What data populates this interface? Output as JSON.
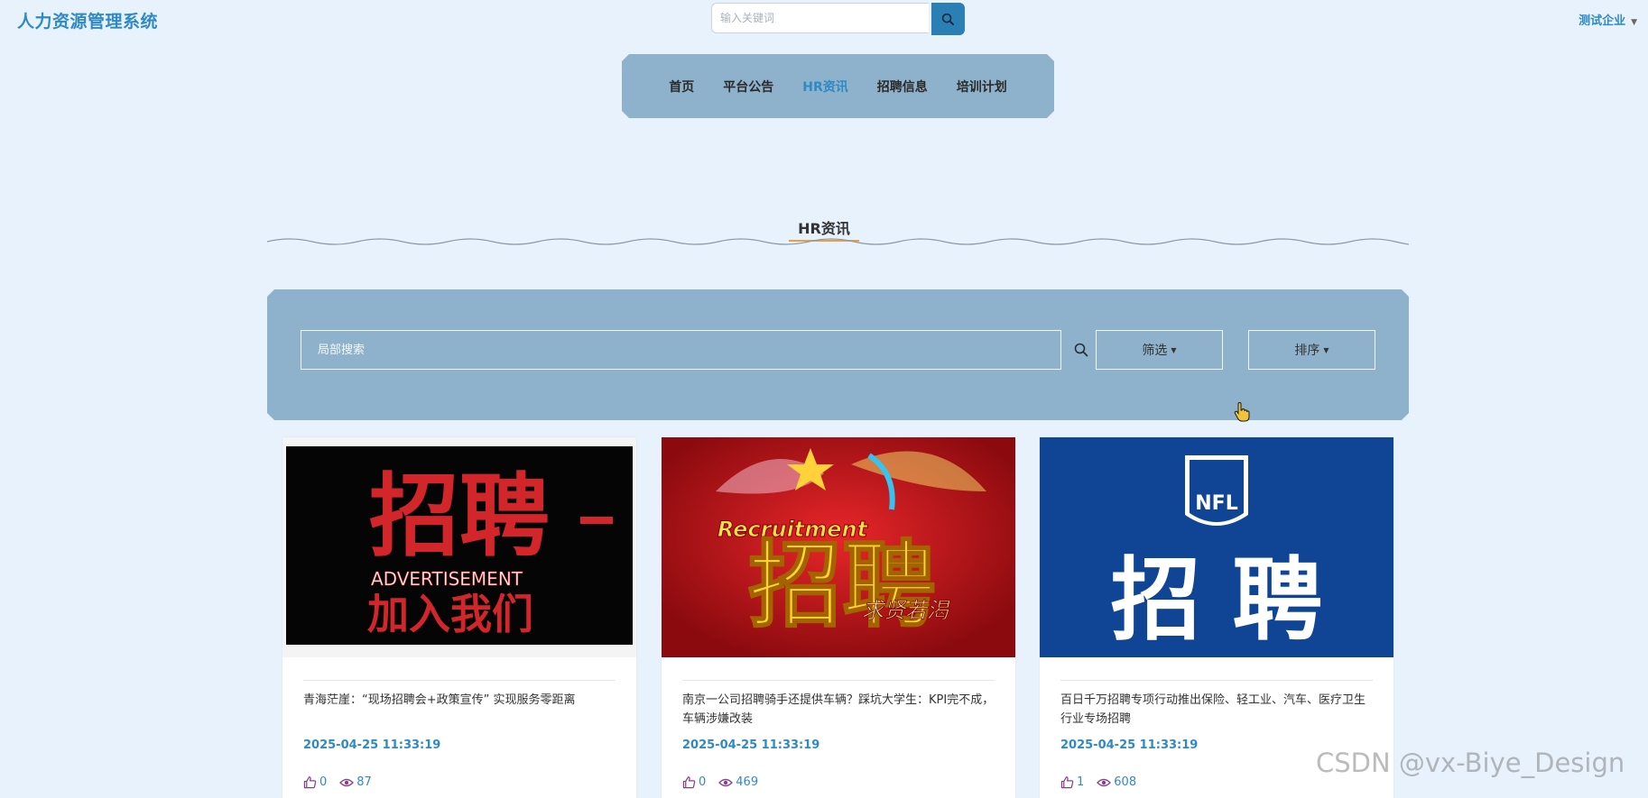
{
  "header": {
    "brand": "人力资源管理系统",
    "search_placeholder": "输入关键词",
    "user_label": "测试企业"
  },
  "nav": {
    "items": [
      {
        "label": "首页"
      },
      {
        "label": "平台公告"
      },
      {
        "label": "HR资讯"
      },
      {
        "label": "招聘信息"
      },
      {
        "label": "培训计划"
      }
    ],
    "active": "HR资讯"
  },
  "section": {
    "title": "HR资讯"
  },
  "filter": {
    "search_placeholder": "局部搜索",
    "filter_label": "筛选",
    "sort_label": "排序"
  },
  "cards": [
    {
      "image_text": {
        "big": "招聘",
        "en": "ADVERTISEMENT",
        "sub": "加入我们"
      },
      "title": "青海茫崖：“现场招聘会+政策宣传” 实现服务零距离",
      "date": "2025-04-25 11:33:19",
      "likes": "0",
      "views": "87"
    },
    {
      "image_text": {
        "big": "招聘",
        "en": "Recruitment",
        "sub": "求贤若渴"
      },
      "title": "南京一公司招聘骑手还提供车辆？踩坑大学生：KPI完不成，车辆涉嫌改装",
      "date": "2025-04-25 11:33:19",
      "likes": "0",
      "views": "469"
    },
    {
      "image_text": {
        "big": "招 聘",
        "logo": "NFL"
      },
      "title": "百日千万招聘专项行动推出保险、轻工业、汽车、医疗卫生行业专场招聘",
      "date": "2025-04-25 11:33:19",
      "likes": "1",
      "views": "608"
    }
  ],
  "watermark": "CSDN @vx-Biye_Design"
}
